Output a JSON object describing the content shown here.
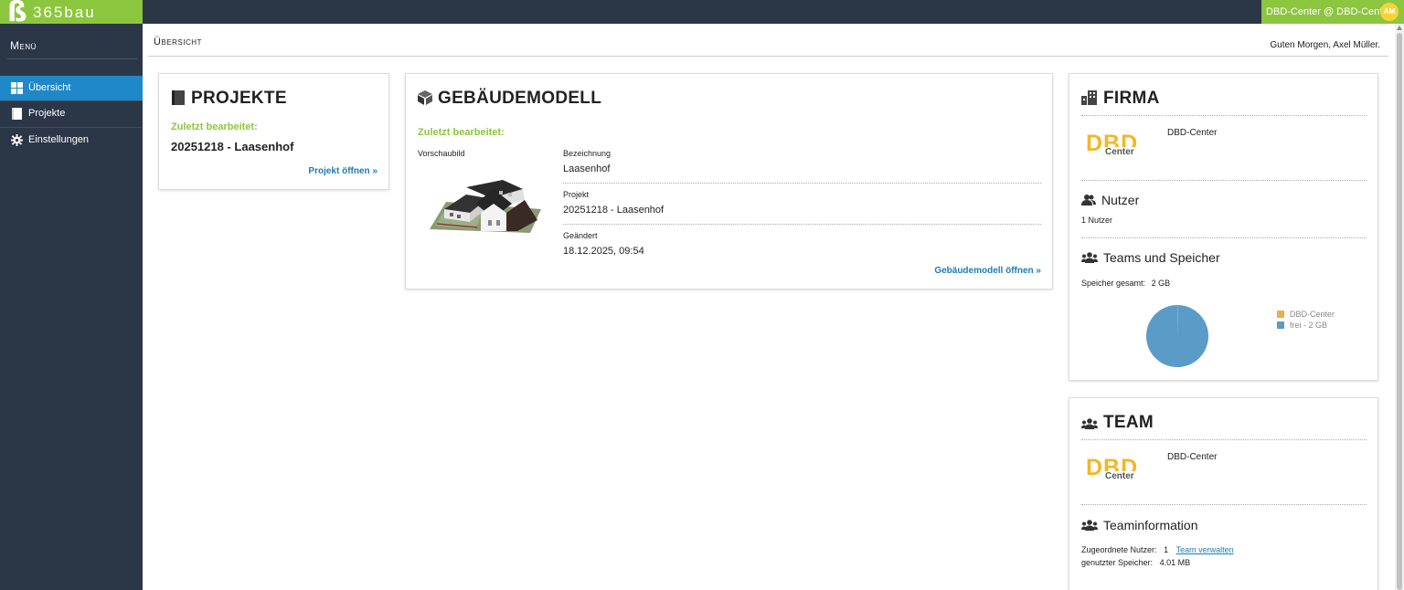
{
  "brand": {
    "mark": "ß",
    "name": "365bau"
  },
  "tenant": {
    "label": "DBD-Center @ DBD-Center",
    "avatar_initials": "AM"
  },
  "sidebar": {
    "title": "Menü",
    "items": [
      {
        "label": "Übersicht",
        "icon": "dashboard-icon",
        "active": true
      },
      {
        "label": "Projekte",
        "icon": "book-icon",
        "active": false
      },
      {
        "label": "Einstellungen",
        "icon": "gear-icon",
        "active": false
      }
    ]
  },
  "header": {
    "breadcrumb": "Übersicht",
    "greeting": "Guten Morgen, Axel Müller."
  },
  "projekte": {
    "title": "PROJEKTE",
    "last_edited_label": "Zuletzt bearbeitet:",
    "project_name": "20251218 - Laasenhof",
    "open_link": "Projekt öffnen »"
  },
  "gebaeudemodell": {
    "title": "GEBÄUDEMODELL",
    "last_edited_label": "Zuletzt bearbeitet:",
    "preview_label": "Vorschaubild",
    "fields": [
      {
        "label": "Bezeichnung",
        "value": "Laasenhof"
      },
      {
        "label": "Projekt",
        "value": "20251218 - Laasenhof"
      },
      {
        "label": "Geändert",
        "value": "18.12.2025, 09:54"
      }
    ],
    "open_link": "Gebäudemodell öffnen »"
  },
  "firma": {
    "title": "FIRMA",
    "company_name": "DBD-Center",
    "logo_text_top": "DBD",
    "logo_text_bottom": "Center",
    "nutzer_title": "Nutzer",
    "nutzer_count": "1 Nutzer",
    "teams_title": "Teams und Speicher",
    "storage_label": "Speicher gesamt:",
    "storage_value": "2 GB"
  },
  "chart_data": {
    "type": "pie",
    "categories": [
      "DBD-Center",
      "frei - 2 GB"
    ],
    "values": [
      0.2,
      99.8
    ],
    "colors": [
      "#f0ad4e",
      "#5b9bc8"
    ],
    "legend_position": "right"
  },
  "team": {
    "title": "TEAM",
    "team_name": "DBD-Center",
    "logo_text_top": "DBD",
    "logo_text_bottom": "Center",
    "info_title": "Teaminformation",
    "assigned_users_label": "Zugeordnete Nutzer:",
    "assigned_users_value": "1",
    "manage_link": "Team verwalten",
    "used_storage_label": "genutzter Speicher:",
    "used_storage_value": "4.01 MB"
  }
}
